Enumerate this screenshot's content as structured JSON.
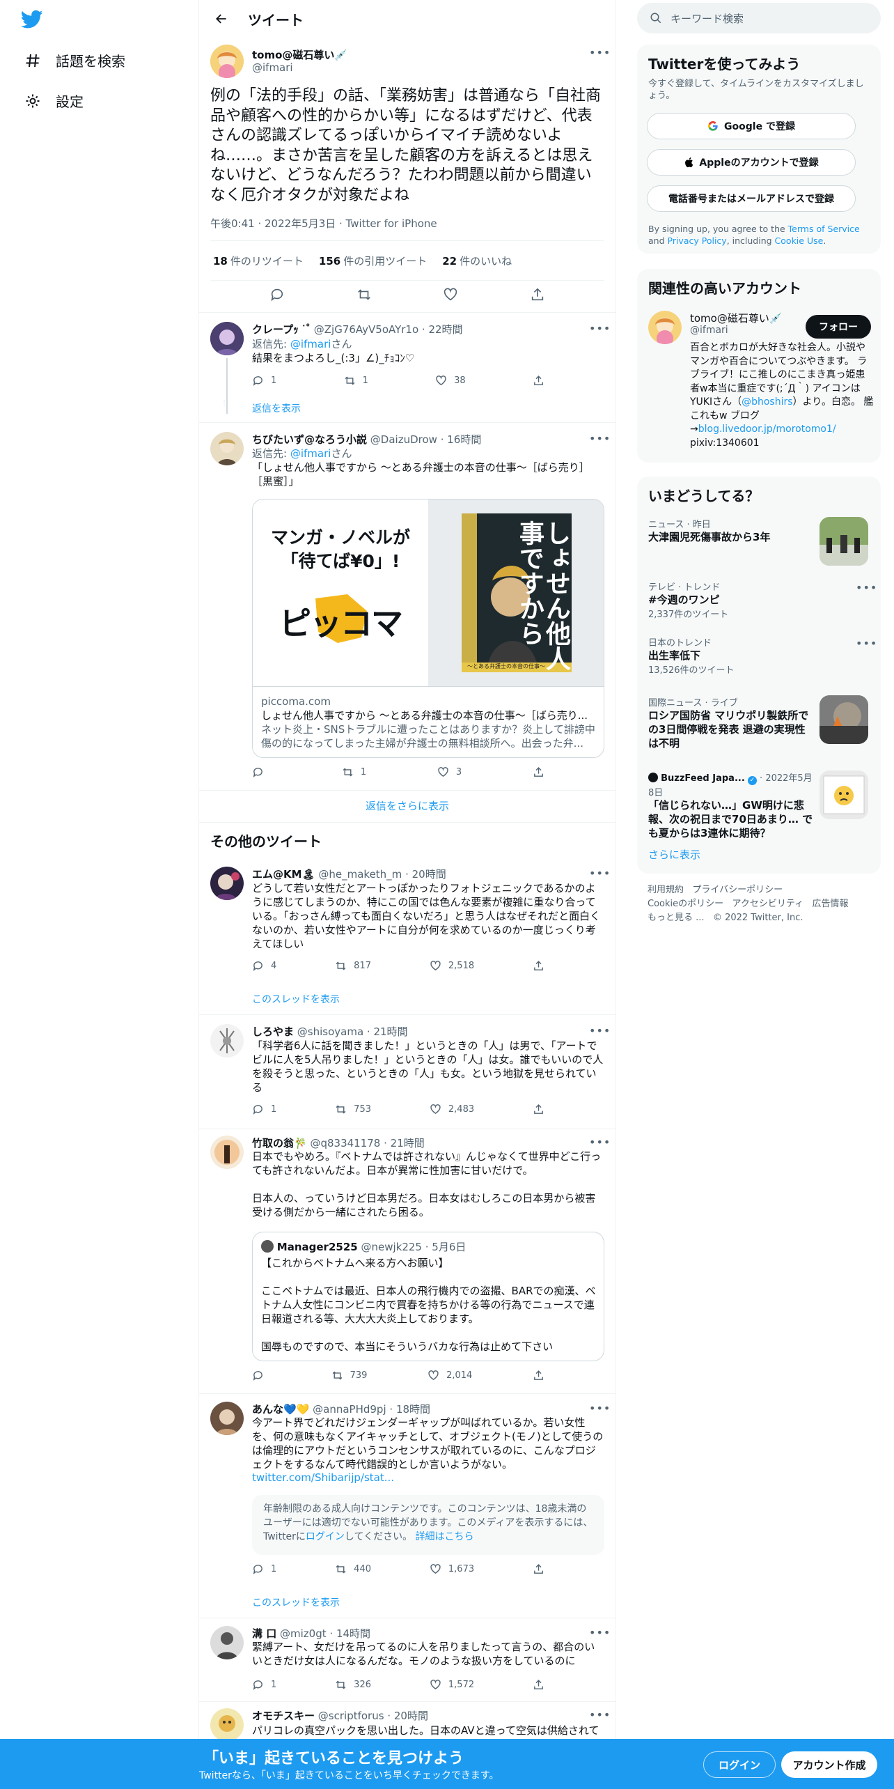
{
  "nav": {
    "explore": "話題を検索",
    "settings": "設定"
  },
  "header": {
    "title": "ツイート"
  },
  "main_tweet": {
    "name": "tomo@磁石尊い💉",
    "handle": "@ifmari",
    "text": "例の「法的手段」の話、「業務妨害」は普通なら「自社商品や顧客への性的からかい等」になるはずだけど、代表さんの認識ズレてるっぽいからイマイチ読めないよね……。まさか苦言を呈した顧客の方を訴えるとは思えないけど、どうなんだろう？たわわ問題以前から間違いなく厄介オタクが対象だよね",
    "meta": "午後0:41 · 2022年5月3日 · Twitter for iPhone",
    "retweets": "18",
    "retweets_label": "件のリツイート",
    "quotes": "156",
    "quotes_label": "件の引用ツイート",
    "likes": "22",
    "likes_label": "件のいいね"
  },
  "replies": [
    {
      "name": "クレープｯ ᐝ˚",
      "handle": "@ZjG76AyV5oAYr1o",
      "time": "22時間",
      "to_prefix": "返信先:",
      "to_handle": "@ifmari",
      "to_suffix": "さん",
      "text": "結果をまつよろし_(:3」∠)_ﾁｮｺﾝ♡",
      "replies": "1",
      "retweets": "1",
      "likes": "38",
      "show": "返信を表示"
    },
    {
      "name": "ちびたいず@なろう小説",
      "handle": "@DaizuDrow",
      "time": "16時間",
      "to_prefix": "返信先:",
      "to_handle": "@ifmari",
      "to_suffix": "さん",
      "text": "「しょせん他人事ですから ～とある弁護士の本音の仕事～［ばら売り］［黒蜜］」",
      "card_ad_line1": "マンガ・ノベルが",
      "card_ad_line2": "「待てば¥0」!",
      "card_ad_logo": "ピッコマ",
      "card_book_title": "しょせん他人事ですから",
      "card_book_sub": "～とある弁護士の本音の仕事～",
      "card_domain": "piccoma.com",
      "card_title": "しょせん他人事ですから ～とある弁護士の本音の仕事～［ばら売り...",
      "card_desc": "ネット炎上・SNSトラブルに遭ったことはありますか？炎上して誹謗中傷の的になってしまった主婦が弁護士の無料相談所へ。出会った弁...",
      "replies": "",
      "retweets": "1",
      "likes": "3"
    }
  ],
  "more_replies": "返信をさらに表示",
  "other_heading": "その他のツイート",
  "others": [
    {
      "name": "エム@KM🏝",
      "handle": "@he_maketh_m",
      "time": "20時間",
      "text": "どうして若い女性だとアートっぽかったりフォトジェニックであるかのように感じてしまうのか、特にこの国では色んな要素が複雑に重なり合っている。「おっさん縛っても面白くないだろ」と思う人はなぜそれだと面白くないのか、若い女性やアートに自分が何を求めているのか一度じっくり考えてほしい",
      "replies": "4",
      "retweets": "817",
      "likes": "2,518",
      "thread": "このスレッドを表示"
    },
    {
      "name": "しろやま",
      "handle": "@shisoyama",
      "time": "21時間",
      "text": "「科学者6人に話を聞きました！」というときの「人」は男で、「アートでビルに人を5人吊りました！」というときの「人」は女。誰でもいいので人を殺そうと思った、というときの「人」も女。という地獄を見せられている",
      "replies": "1",
      "retweets": "753",
      "likes": "2,483"
    },
    {
      "name": "竹取の翁🎋",
      "handle": "@q83341178",
      "time": "21時間",
      "text1": "日本でもやめろ。『ベトナムでは許されない』んじゃなくて世界中どこ行っても許されないんだよ。日本が異常に性加害に甘いだけで。",
      "text2": "日本人の、っていうけど日本男だろ。日本女はむしろこの日本男から被害受ける側だから一緒にされたら困る。",
      "q_name": "Manager2525",
      "q_handle": "@newjk225",
      "q_time": "5月6日",
      "q_text1": "【これからベトナムへ来る方へお願い】",
      "q_text2": "ここベトナムでは最近、日本人の飛行機内での盗撮、BARでの痴漢、ベトナム人女性にコンビニ内で買春を持ちかける等の行為でニュースで連日報道される等、大大大大炎上しております。",
      "q_text3": "国辱ものですので、本当にそういうバカな行為は止めて下さい",
      "replies": "",
      "retweets": "739",
      "likes": "2,014"
    },
    {
      "name": "あんな💙💛",
      "handle": "@annaPHd9pj",
      "time": "18時間",
      "text": "今アート界でどれだけジェンダーギャップが叫ばれているか。若い女性を、何の意味もなくアイキャッチとして、オブジェクト(モノ)として使うのは倫理的にアウトだというコンセンサスが取れているのに、こんなプロジェクトをするなんて時代錯誤的としか言いようがない。",
      "link": "twitter.com/Shibarijp/stat...",
      "warn1": "年齢制限のある成人向けコンテンツです。このコンテンツは、18歳未満のユーザーには適切でない可能性があります。このメディアを表示するには、Twitterに",
      "warn_login": "ログイン",
      "warn2": "してください。",
      "warn_more": "詳細はこちら",
      "replies": "1",
      "retweets": "440",
      "likes": "1,673",
      "thread": "このスレッドを表示"
    },
    {
      "name": "溝 口",
      "handle": "@miz0gt",
      "time": "14時間",
      "text": "緊縛アート、女だけを吊ってるのに人を吊りましたって言うの、都合のいいときだけ女は人になるんだな。モノのような扱い方をしているのに",
      "replies": "1",
      "retweets": "326",
      "likes": "1,572"
    },
    {
      "name": "オモチスキー",
      "handle": "@scriptforus",
      "time": "20時間",
      "text": "パリコレの真空パックを思い出した。日本のAVと違って空気は供給されて"
    }
  ],
  "search": {
    "placeholder": "キーワード検索"
  },
  "signup": {
    "title": "Twitterを使ってみよう",
    "sub": "今すぐ登録して、タイムラインをカスタマイズしましょう。",
    "google": "Google で登録",
    "apple": "Appleのアカウントで登録",
    "phone": "電話番号またはメールアドレスで登録",
    "legal1": "By signing up, you agree to the ",
    "tos": "Terms of Service",
    "legal2": " and ",
    "privacy": "Privacy Policy",
    "legal3": ", including ",
    "cookie": "Cookie Use",
    "legal4": "."
  },
  "related": {
    "title": "関連性の高いアカウント",
    "name": "tomo@磁石尊い💉",
    "handle": "@ifmari",
    "follow": "フォロー",
    "bio1": "百合とボカロが大好きな社会人。小説やマンガや百合についてつぶやきます。 ラブライブ！にこ推しのにこまき真っ姫患者w本当に重症です(;´Д｀) アイコンはYUKIさん（",
    "bio_link": "@bhoshirs",
    "bio2": "）より。白恋。 艦これもw ブログ→",
    "blog": "blog.livedoor.jp/morotomo1/",
    "pixiv": "pixiv:1340601"
  },
  "trends": {
    "title": "いまどうしてる？",
    "items": [
      {
        "ctx": "ニュース · 昨日",
        "title": "大津園児死傷事故から3年"
      },
      {
        "ctx": "テレビ · トレンド",
        "title": "#今週のワンピ",
        "count": "2,337件のツイート"
      },
      {
        "ctx": "日本のトレンド",
        "title": "出生率低下",
        "count": "13,526件のツイート"
      },
      {
        "ctx": "国際ニュース · ライブ",
        "title": "ロシア国防省 マリウポリ製鉄所での3日間停戦を発表 退避の実現性は不明"
      },
      {
        "src": "BuzzFeed Japa...",
        "date": "2022年5月8日",
        "title": "「信じられない…」GW明けに悲報、次の祝日まで70日あまり… でも夏からは3連休に期待？"
      }
    ],
    "more": "さらに表示"
  },
  "footer": {
    "tos": "利用規約",
    "privacy": "プライバシーポリシー",
    "cookie": "Cookieのポリシー",
    "access": "アクセシビリティ",
    "ads": "広告情報",
    "more": "もっと見る ...",
    "copy": "© 2022 Twitter, Inc."
  },
  "banner": {
    "title": "「いま」起きていることを見つけよう",
    "sub": "Twitterなら、「いま」起きていることをいち早くチェックできます。",
    "login": "ログイン",
    "signup": "アカウント作成"
  },
  "colors": {
    "accent": "#1d9bf0",
    "text": "#0f1419",
    "muted": "#536471",
    "border": "#eff3f4"
  }
}
